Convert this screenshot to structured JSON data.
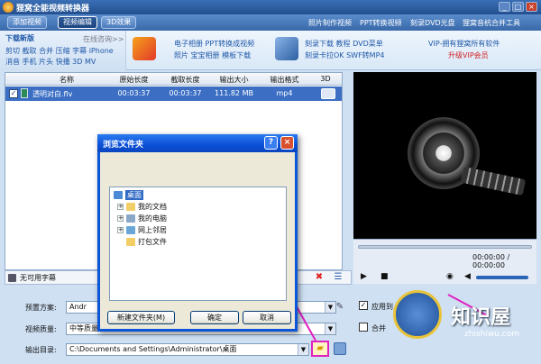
{
  "app": {
    "title": "狸窝全能视频转换器"
  },
  "toolbar": {
    "buttons": [
      "添加视频",
      "视频编辑",
      "3D效果"
    ],
    "links": [
      "照片制作视频",
      "PPT转换视频",
      "刻录DVD光盘",
      "狸窝音杭合并工具"
    ]
  },
  "banner": {
    "download": "下载新版",
    "online": "在线咨询>>",
    "tools_row1": "剪切 截取 合并 压缩 字幕 iPhone",
    "tools_row2": "消音 手机 片头 快播 3D MV",
    "promo1": [
      "电子相册 PPT转换成视频",
      "照片 宝宝相册 模板下载"
    ],
    "promo2": [
      "刻录下载 教程 DVD菜单",
      "刻录卡拉OK SWF转MP4"
    ],
    "vip": "VIP-拥有狸窝所有软件",
    "vip_link": "升级VIP会员"
  },
  "table": {
    "headers": [
      "名称",
      "原始长度",
      "截取长度",
      "输出大小",
      "输出格式",
      "3D"
    ],
    "rows": [
      {
        "name": "透明对白.flv",
        "orig": "00:03:37",
        "cut": "00:03:37",
        "size": "111.82 MB",
        "format": "mp4"
      }
    ]
  },
  "subtitle": {
    "value": "无可用字幕"
  },
  "preview": {
    "time": "00:00:00 / 00:00:00"
  },
  "settings": {
    "preset_label": "预置方案:",
    "preset_value": "Andr",
    "quality_label": "视频质量:",
    "quality_value": "中等质量",
    "output_label": "输出目录:",
    "output_value": "C:\\Documents and Settings\\Administrator\\桌面",
    "apply_all": "应用到",
    "merge": "合并"
  },
  "dialog": {
    "title": "浏览文件夹",
    "help": "?",
    "close": "×",
    "tree": [
      "桌面",
      "我的文档",
      "我的电脑",
      "网上邻居",
      "打包文件"
    ],
    "new_folder": "新建文件夹(M)",
    "ok": "确定",
    "cancel": "取消"
  },
  "watermark": {
    "brand": "知识屋",
    "url": "zhishiwu.com"
  },
  "colors": {
    "accent": "#0a55d8",
    "selection": "#3c6fc4",
    "highlight_arrow": "#e020c0"
  }
}
